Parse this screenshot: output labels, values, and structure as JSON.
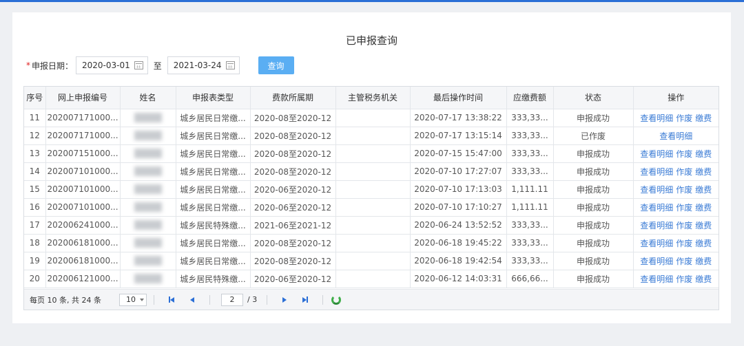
{
  "page": {
    "title": "已申报查询"
  },
  "filter": {
    "required_mark": "*",
    "label": "申报日期：",
    "start_date": "2020-03-01",
    "to": "至",
    "end_date": "2021-03-24",
    "query_label": "查询"
  },
  "table": {
    "headers": [
      "序号",
      "网上申报编号",
      "姓名",
      "申报表类型",
      "费款所属期",
      "主管税务机关",
      "最后操作时间",
      "应缴费额",
      "状态",
      "操作"
    ],
    "rows": [
      {
        "seq": "11",
        "no": "202007171000...",
        "type": "城乡居民日常缴...",
        "period": "2020-08至2020-12",
        "office": "",
        "time": "2020-07-17 13:38:22",
        "amount": "333,33...",
        "status": "申报成功",
        "ops": [
          "查看明细",
          "作废",
          "缴费"
        ]
      },
      {
        "seq": "12",
        "no": "202007171000...",
        "type": "城乡居民日常缴...",
        "period": "2020-08至2020-12",
        "office": "",
        "time": "2020-07-17 13:15:14",
        "amount": "333,33...",
        "status": "已作废",
        "ops": [
          "查看明细"
        ]
      },
      {
        "seq": "13",
        "no": "202007151000...",
        "type": "城乡居民日常缴...",
        "period": "2020-08至2020-12",
        "office": "",
        "time": "2020-07-15 15:47:00",
        "amount": "333,33...",
        "status": "申报成功",
        "ops": [
          "查看明细",
          "作废",
          "缴费"
        ]
      },
      {
        "seq": "14",
        "no": "202007101000...",
        "type": "城乡居民日常缴...",
        "period": "2020-08至2020-12",
        "office": "",
        "time": "2020-07-10 17:27:07",
        "amount": "333,33...",
        "status": "申报成功",
        "ops": [
          "查看明细",
          "作废",
          "缴费"
        ]
      },
      {
        "seq": "15",
        "no": "202007101000...",
        "type": "城乡居民日常缴...",
        "period": "2020-06至2020-12",
        "office": "",
        "time": "2020-07-10 17:13:03",
        "amount": "1,111.11",
        "status": "申报成功",
        "ops": [
          "查看明细",
          "作废",
          "缴费"
        ]
      },
      {
        "seq": "16",
        "no": "202007101000...",
        "type": "城乡居民日常缴...",
        "period": "2020-06至2020-12",
        "office": "",
        "time": "2020-07-10 17:10:27",
        "amount": "1,111.11",
        "status": "申报成功",
        "ops": [
          "查看明细",
          "作废",
          "缴费"
        ]
      },
      {
        "seq": "17",
        "no": "202006241000...",
        "type": "城乡居民特殊缴...",
        "period": "2021-06至2021-12",
        "office": "",
        "time": "2020-06-24 13:52:52",
        "amount": "333,33...",
        "status": "申报成功",
        "ops": [
          "查看明细",
          "作废",
          "缴费"
        ]
      },
      {
        "seq": "18",
        "no": "202006181000...",
        "type": "城乡居民日常缴...",
        "period": "2020-08至2020-12",
        "office": "",
        "time": "2020-06-18 19:45:22",
        "amount": "333,33...",
        "status": "申报成功",
        "ops": [
          "查看明细",
          "作废",
          "缴费"
        ]
      },
      {
        "seq": "19",
        "no": "202006181000...",
        "type": "城乡居民日常缴...",
        "period": "2020-08至2020-12",
        "office": "",
        "time": "2020-06-18 19:42:54",
        "amount": "333,33...",
        "status": "申报成功",
        "ops": [
          "查看明细",
          "作废",
          "缴费"
        ]
      },
      {
        "seq": "20",
        "no": "202006121000...",
        "type": "城乡居民特殊缴...",
        "period": "2020-06至2020-12",
        "office": "",
        "time": "2020-06-12 14:03:31",
        "amount": "666,66...",
        "status": "申报成功",
        "ops": [
          "查看明细",
          "作废",
          "缴费"
        ]
      }
    ]
  },
  "pager": {
    "summary": "每页 10 条, 共 24 条",
    "page_size": "10",
    "current_page": "2",
    "total_pages": "/ 3"
  },
  "icons": {
    "date": "calendar-icon",
    "first": "first-page-icon",
    "prev": "prev-page-icon",
    "next": "next-page-icon",
    "last": "last-page-icon",
    "refresh": "refresh-icon"
  },
  "colors": {
    "accent": "#2b6fd6",
    "query_button": "#5aaef3",
    "link": "#3a7bd5",
    "refresh": "#3fae49"
  }
}
